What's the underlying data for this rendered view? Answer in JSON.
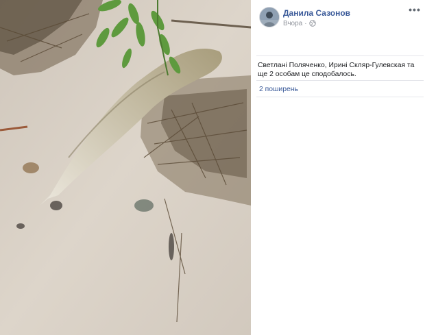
{
  "post": {
    "author_name": "Данила Сазонов",
    "timestamp": "Вчора",
    "privacy_icon": "globe-icon",
    "more_icon": "more-options-icon",
    "more_label": "•••",
    "photo_subject": "fish-on-sand-photo"
  },
  "reactions": {
    "likes_text": "Светлані Поляченко, Ирині Скляр-Гулевская та ще 2 особам це сподобалось.",
    "shares_text": "2 поширень"
  },
  "colors": {
    "link": "#385898",
    "meta": "#90949c",
    "text": "#1c1e21",
    "divider": "#e5e6eb"
  }
}
